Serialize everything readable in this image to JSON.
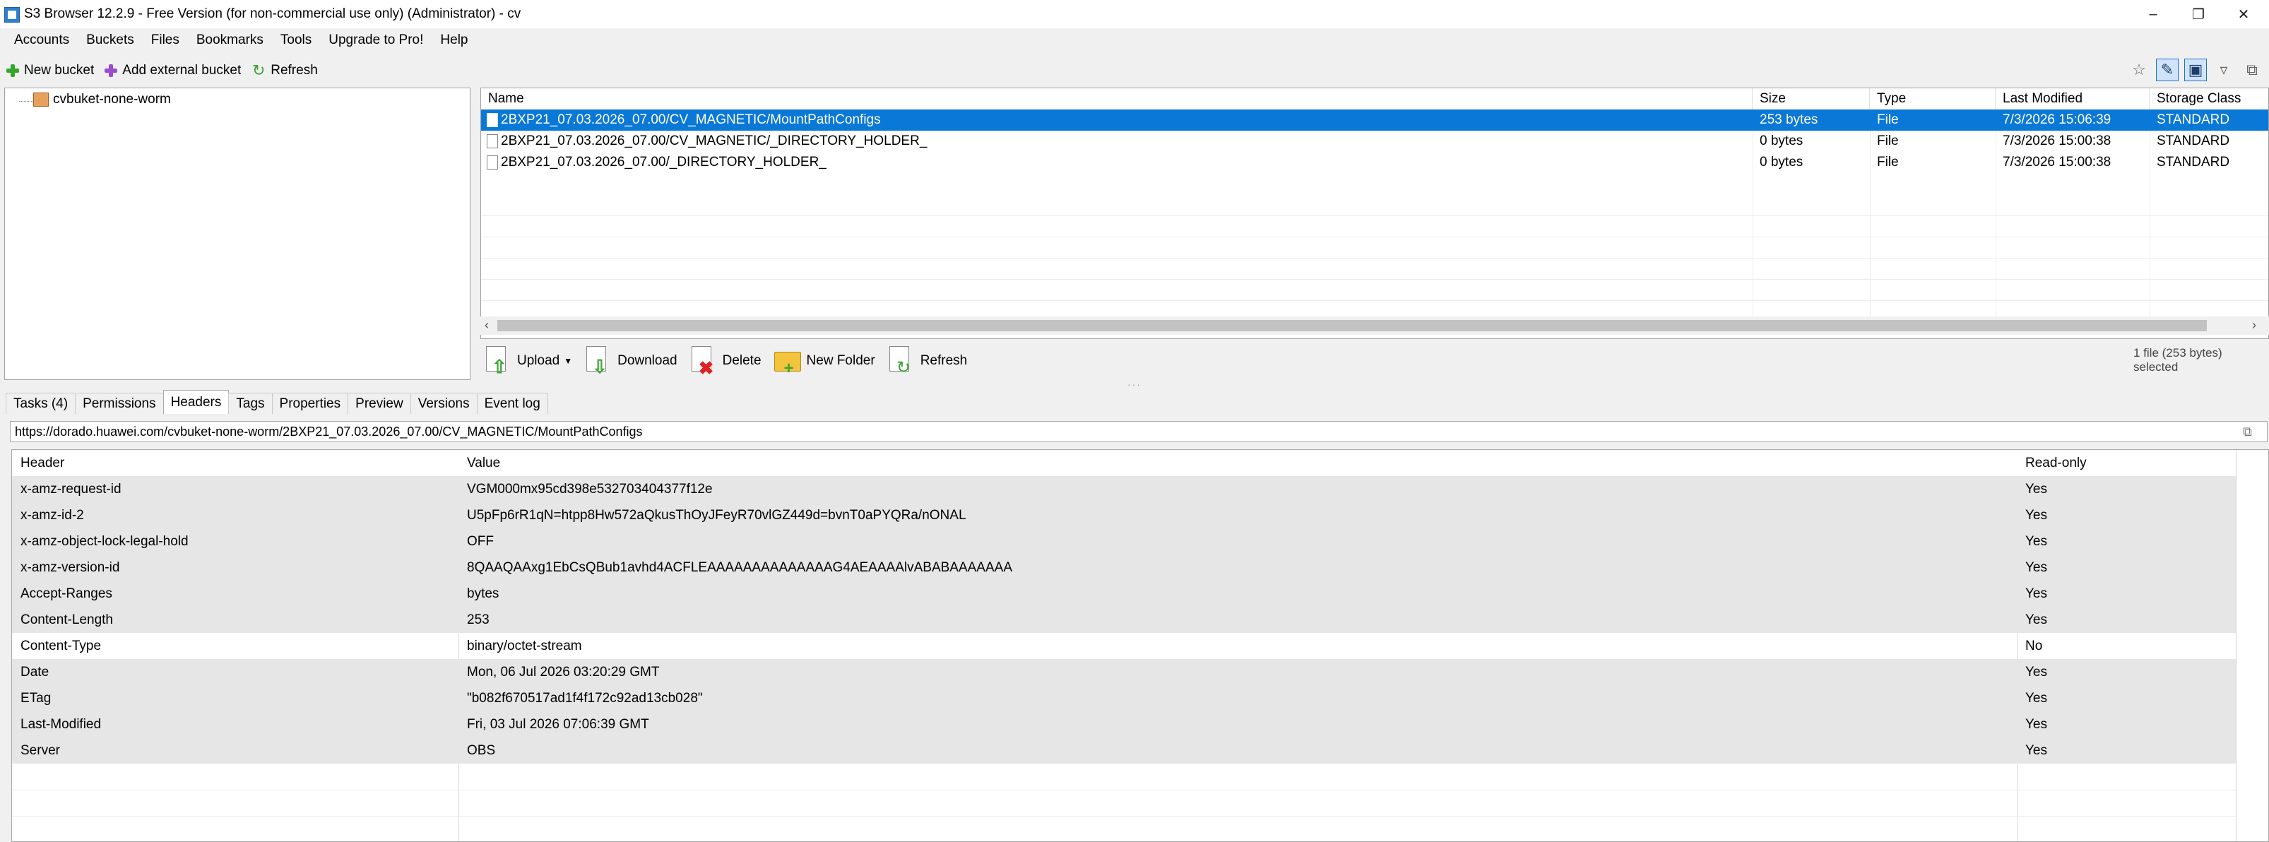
{
  "window": {
    "title": "S3 Browser 12.2.9 - Free Version (for non-commercial use only) (Administrator) - cv"
  },
  "menu": [
    "Accounts",
    "Buckets",
    "Files",
    "Bookmarks",
    "Tools",
    "Upgrade to Pro!",
    "Help"
  ],
  "toolbar": {
    "new_bucket": "New bucket",
    "add_external_bucket": "Add external bucket",
    "refresh": "Refresh"
  },
  "tree": {
    "bucket": "cvbuket-none-worm"
  },
  "file_list": {
    "columns": [
      "Name",
      "Size",
      "Type",
      "Last Modified",
      "Storage Class"
    ],
    "rows": [
      {
        "name": "2BXP21_07.03.2026_07.00/CV_MAGNETIC/MountPathConfigs",
        "size": "253 bytes",
        "type": "File",
        "modified": "7/3/2026 15:06:39",
        "class": "STANDARD"
      },
      {
        "name": "2BXP21_07.03.2026_07.00/CV_MAGNETIC/_DIRECTORY_HOLDER_",
        "size": "0 bytes",
        "type": "File",
        "modified": "7/3/2026 15:00:38",
        "class": "STANDARD"
      },
      {
        "name": "2BXP21_07.03.2026_07.00/_DIRECTORY_HOLDER_",
        "size": "0 bytes",
        "type": "File",
        "modified": "7/3/2026 15:00:38",
        "class": "STANDARD"
      }
    ]
  },
  "actions": {
    "upload": "Upload",
    "download": "Download",
    "delete": "Delete",
    "new_folder": "New Folder",
    "refresh": "Refresh"
  },
  "status": {
    "selection": "1 file (253 bytes) selected"
  },
  "tabs": [
    "Tasks (4)",
    "Permissions",
    "Headers",
    "Tags",
    "Properties",
    "Preview",
    "Versions",
    "Event log"
  ],
  "active_tab": "Headers",
  "url": "https://dorado.huawei.com/cvbuket-none-worm/2BXP21_07.03.2026_07.00/CV_MAGNETIC/MountPathConfigs",
  "headers_table": {
    "columns": [
      "Header",
      "Value",
      "Read-only"
    ],
    "rows": [
      {
        "h": "x-amz-request-id",
        "v": "VGM000mx95cd398e532703404377f12e",
        "r": "Yes"
      },
      {
        "h": "x-amz-id-2",
        "v": "U5pFp6rR1qN=htpp8Hw572aQkusThOyJFeyR70vlGZ449d=bvnT0aPYQRa/nONAL",
        "r": "Yes"
      },
      {
        "h": "x-amz-object-lock-legal-hold",
        "v": "OFF",
        "r": "Yes"
      },
      {
        "h": "x-amz-version-id",
        "v": "8QAAQAAxg1EbCsQBub1avhd4ACFLEAAAAAAAAAAAAAAG4AEAAAAlvABABAAAAAAA",
        "r": "Yes"
      },
      {
        "h": "Accept-Ranges",
        "v": "bytes",
        "r": "Yes"
      },
      {
        "h": "Content-Length",
        "v": "253",
        "r": "Yes"
      },
      {
        "h": "Content-Type",
        "v": "binary/octet-stream",
        "r": "No"
      },
      {
        "h": "Date",
        "v": "Mon, 06 Jul 2026 03:20:29 GMT",
        "r": "Yes"
      },
      {
        "h": "ETag",
        "v": "\"b082f670517ad1f4f172c92ad13cb028\"",
        "r": "Yes"
      },
      {
        "h": "Last-Modified",
        "v": "Fri, 03 Jul 2026 07:06:39 GMT",
        "r": "Yes"
      },
      {
        "h": "Server",
        "v": "OBS",
        "r": "Yes"
      }
    ]
  },
  "colors": {
    "selection": "#0a78d7",
    "accent": "#35a52b"
  }
}
